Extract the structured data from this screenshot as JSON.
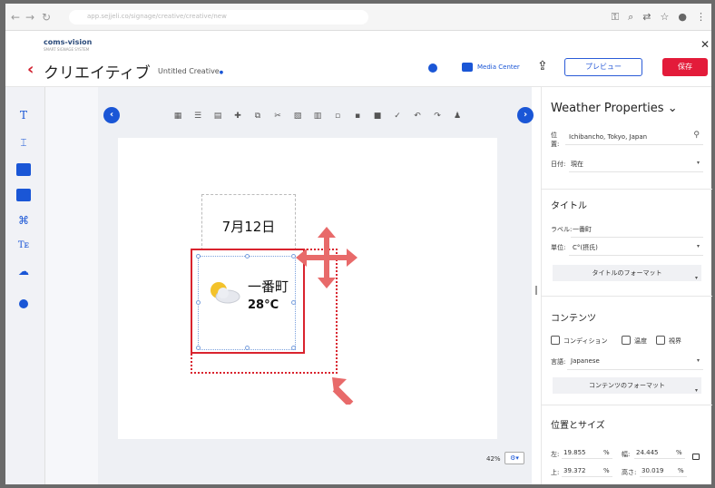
{
  "browser": {
    "url": "app.sejjeli.co/signage/creative/creative/new"
  },
  "app": {
    "logo": "coms-vision",
    "logo_sub": "SMART SIGNAGE SYSTEM",
    "close": "✕",
    "back": "‹",
    "title": "クリエイティブ",
    "creative_name": "Untitled Creative",
    "unsaved_dot": "●",
    "media_center": "Media Center",
    "preview": "プレビュー",
    "save": "保存"
  },
  "leftbar": {
    "items": [
      {
        "icon": "text-icon",
        "glyph": "T"
      },
      {
        "icon": "text-frame-icon",
        "glyph": "⌶"
      },
      {
        "icon": "image-icon",
        "glyph": "▣"
      },
      {
        "icon": "video-icon",
        "glyph": "▦"
      },
      {
        "icon": "media-link-icon",
        "glyph": "⌘"
      },
      {
        "icon": "ticker-icon",
        "glyph": "Tᴇ"
      },
      {
        "icon": "weather-icon",
        "glyph": "☁"
      },
      {
        "icon": "clock-icon",
        "glyph": "●"
      }
    ]
  },
  "canvas": {
    "collapse_left": "‹",
    "collapse_right": "›",
    "date_text": "7月12日",
    "weather_name": "一番町",
    "weather_temp": "28°C",
    "zoom": "42%",
    "zoom_btn": "⚙▾"
  },
  "properties": {
    "title": "Weather Properties",
    "title_caret": "⌄",
    "location_label": "位置:",
    "location_value": "Ichibancho, Tokyo, Japan",
    "date_label": "日付:",
    "date_value": "現在",
    "section_title": "タイトル",
    "label_label": "ラベル:",
    "label_value": "一番町",
    "unit_label": "単位:",
    "unit_value": "C°(摂氏)",
    "title_format_btn": "タイトルのフォーマット",
    "section_content": "コンテンツ",
    "chk_condition": "コンディション",
    "chk_temp": "温度",
    "chk_humidity": "視界",
    "lang_label": "言語:",
    "lang_value": "Japanese",
    "content_format_btn": "コンテンツのフォーマット",
    "section_pos": "位置とサイズ",
    "left_label": "左:",
    "left_value": "19.855",
    "width_label": "幅:",
    "width_value": "24.445",
    "top_label": "上:",
    "top_value": "39.372",
    "height_label": "高さ:",
    "height_value": "30.019",
    "pct": "%"
  },
  "colors": {
    "accent": "#1a56d6",
    "danger": "#e31b3a",
    "annotation": "#d9232e"
  }
}
